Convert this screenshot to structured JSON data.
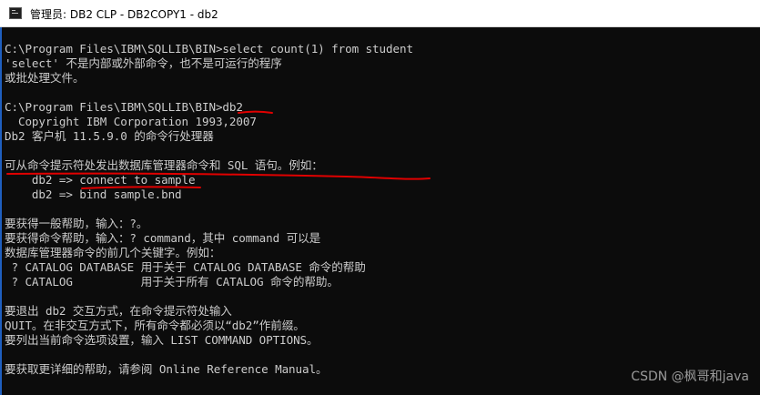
{
  "window": {
    "title": "管理员: DB2 CLP - DB2COPY1 - db2",
    "icon": "console-icon"
  },
  "console": {
    "lines": [
      "C:\\Program Files\\IBM\\SQLLIB\\BIN>select count(1) from student",
      "'select' 不是内部或外部命令，也不是可运行的程序",
      "或批处理文件。",
      "",
      "C:\\Program Files\\IBM\\SQLLIB\\BIN>db2",
      "  Copyright IBM Corporation 1993,2007",
      "Db2 客户机 11.5.9.0 的命令行处理器",
      "",
      "可从命令提示符处发出数据库管理器命令和 SQL 语句。例如：",
      "    db2 => connect to sample",
      "    db2 => bind sample.bnd",
      "",
      "要获得一般帮助，输入：?。",
      "要获得命令帮助，输入：? command，其中 command 可以是",
      "数据库管理器命令的前几个关键字。例如：",
      " ? CATALOG DATABASE 用于关于 CATALOG DATABASE 命令的帮助",
      " ? CATALOG          用于关于所有 CATALOG 命令的帮助。",
      "",
      "要退出 db2 交互方式，在命令提示符处输入",
      "QUIT。在非交互方式下，所有命令都必须以“db2”作前缀。",
      "要列出当前命令选项设置，输入 LIST COMMAND OPTIONS。",
      "",
      "要获取更详细的帮助，请参阅 Online Reference Manual。"
    ]
  },
  "annotation_color": "#e00000",
  "watermark": "CSDN @枫哥和java",
  "colors": {
    "console_bg": "#0c0c0c",
    "console_text": "#cccccc",
    "titlebar_bg": "#ffffff"
  }
}
